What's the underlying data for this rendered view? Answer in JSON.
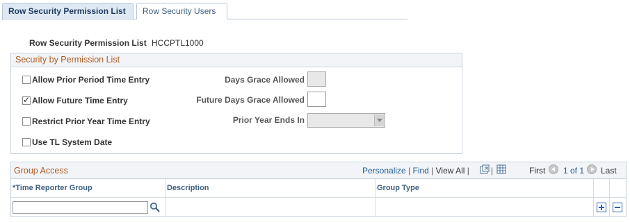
{
  "tabs": [
    {
      "label": "Row Security Permission List",
      "active": true
    },
    {
      "label": "Row Security Users",
      "active": false
    }
  ],
  "permission_list": {
    "label": "Row Security Permission List",
    "value": "HCCPTL1000"
  },
  "security_section": {
    "title": "Security by Permission List",
    "checkboxes": [
      {
        "label": "Allow Prior Period Time Entry",
        "checked": false
      },
      {
        "label": "Allow Future Time Entry",
        "checked": true
      },
      {
        "label": "Restrict Prior Year Time Entry",
        "checked": false
      },
      {
        "label": "Use TL System Date",
        "checked": false
      }
    ],
    "days_grace_label": "Days Grace Allowed",
    "future_days_grace_label": "Future Days Grace Allowed",
    "prior_year_ends_label": "Prior Year Ends In"
  },
  "group_access": {
    "title": "Group Access",
    "toolbar": {
      "personalize": "Personalize",
      "find": "Find",
      "view_all": "View All",
      "first": "First",
      "range": "1 of 1",
      "last": "Last"
    },
    "columns": [
      "*Time Reporter Group",
      "Description",
      "Group Type"
    ]
  },
  "colors": {
    "section_title": "#b35a1f",
    "link": "#1f5c99",
    "column_header": "#3f5f7f"
  }
}
